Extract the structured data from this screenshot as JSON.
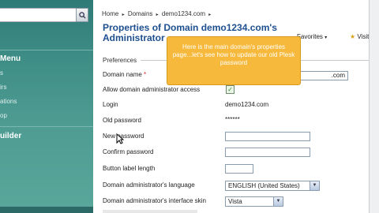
{
  "sidebar": {
    "menu_heading": "Menu",
    "builder_heading": "uilder",
    "links": [
      "s",
      "irs",
      "ations",
      "op",
      "",
      ""
    ]
  },
  "breadcrumb": {
    "home": "Home",
    "sep1": "▸",
    "domains": "Domains",
    "sep2": "▸",
    "domain": "demo1234.com",
    "sep3": "▸"
  },
  "page_title": "Properties of Domain demo1234.com's Administrator",
  "toolbar": {
    "favorites": "Favorites",
    "visited": "Visited"
  },
  "section": {
    "preferences": "Preferences"
  },
  "form": {
    "domain_name_label": "Domain name",
    "required_marker": "*",
    "domain_name_value": ".com",
    "allow_admin_label": "Allow domain administrator access",
    "login_label": "Login",
    "login_value": "demo1234.com",
    "old_password_label": "Old password",
    "old_password_value": "******",
    "new_password_label": "New password",
    "confirm_password_label": "Confirm password",
    "button_label_length_label": "Button label length",
    "language_label": "Domain administrator's language",
    "language_value": "ENGLISH (United States)",
    "skin_label": "Domain administrator's interface skin",
    "skin_value": "Vista"
  },
  "tooltip": {
    "text": "Here is the main domain's properties page...let's see how to update our old Plesk password"
  },
  "colors": {
    "title_blue": "#1e4f8f",
    "tooltip_orange": "#f6b93b",
    "sidebar_teal": "#3f8f87"
  }
}
